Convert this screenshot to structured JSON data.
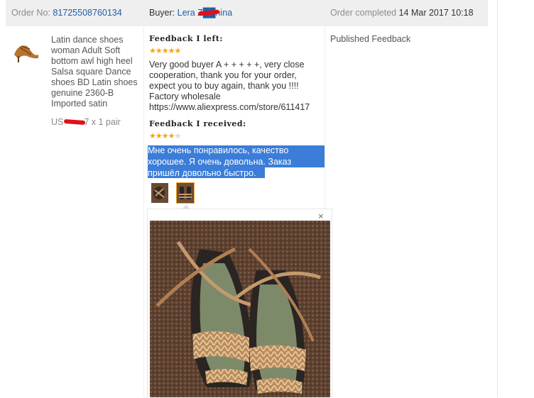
{
  "header": {
    "order_label": "Order No:",
    "order_number": "81725508760134",
    "buyer_label": "Buyer:",
    "buyer_name": "Lera Z██nina",
    "status_label": "Order completed",
    "completed_date": "14 Mar 2017 10:18"
  },
  "product": {
    "title": "Latin dance shoes woman Adult Soft bottom awl high heel Salsa square Dance shoes BD Latin shoes genuine 2360-B Imported satin",
    "price_prefix": "US",
    "price_suffix": "7 x 1 pair"
  },
  "feedback_left": {
    "label": "Feedback I left:",
    "rating": 5,
    "text": "Very good buyer A + + + + +, very close cooperation, thank you for your order, expect you to buy again, thank you !!!! Factory wholesale https://www.aliexpress.com/store/611417"
  },
  "feedback_received": {
    "label": "Feedback I received:",
    "rating": 4,
    "text": "Мне очень понравилось, качество хорошее. Я очень довольна. Заказ пришёл довольно быстро."
  },
  "status": {
    "published": "Published Feedback"
  },
  "preview": {
    "close": "×"
  },
  "colors": {
    "link": "#1f5ea8",
    "star": "#f7a21b",
    "highlight": "#3b7dd8",
    "redaction": "#e0101a"
  }
}
